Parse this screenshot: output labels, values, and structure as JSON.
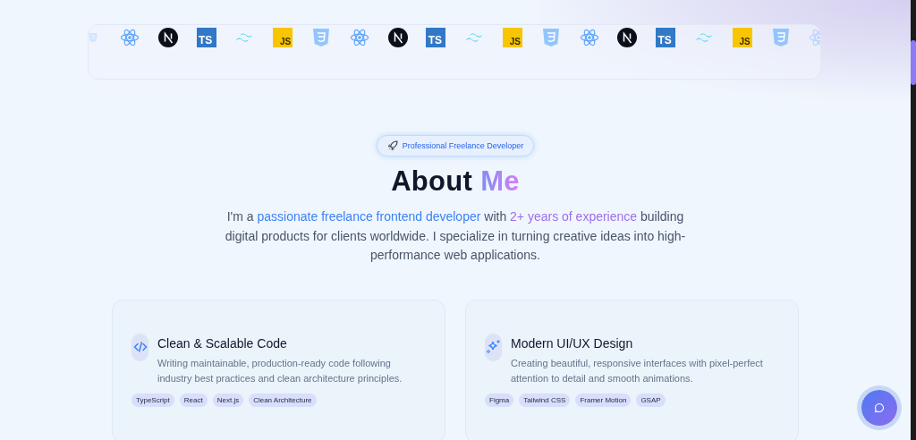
{
  "tech_strip": [
    {
      "kind": "css",
      "faded": true
    },
    {
      "kind": "react",
      "faded": false
    },
    {
      "kind": "next",
      "faded": false
    },
    {
      "kind": "ts",
      "label": "TS",
      "faded": false
    },
    {
      "kind": "tailwind",
      "faded": false
    },
    {
      "kind": "js",
      "label": "JS",
      "faded": false
    },
    {
      "kind": "css",
      "faded": false
    },
    {
      "kind": "react",
      "faded": false
    },
    {
      "kind": "next",
      "faded": false
    },
    {
      "kind": "ts",
      "label": "TS",
      "faded": false
    },
    {
      "kind": "tailwind",
      "faded": false
    },
    {
      "kind": "js",
      "label": "JS",
      "faded": false
    },
    {
      "kind": "css",
      "faded": false
    },
    {
      "kind": "react",
      "faded": false
    },
    {
      "kind": "next",
      "faded": false
    },
    {
      "kind": "ts",
      "label": "TS",
      "faded": false
    },
    {
      "kind": "tailwind",
      "faded": false
    },
    {
      "kind": "js",
      "label": "JS",
      "faded": false
    },
    {
      "kind": "css",
      "faded": false
    },
    {
      "kind": "react",
      "faded": true
    }
  ],
  "badge": "Professional Freelance Developer",
  "heading": {
    "main": "About",
    "accent": "Me"
  },
  "intro": [
    {
      "text": "I'm a ",
      "kind": "plain"
    },
    {
      "text": "passionate freelance frontend developer",
      "kind": "blue"
    },
    {
      "text": " with ",
      "kind": "plain"
    },
    {
      "text": "2+ years of experience",
      "kind": "purple"
    },
    {
      "text": " building digital products for clients worldwide. I specialize in turning creative ideas into high-performance web applications.",
      "kind": "plain"
    }
  ],
  "cards": [
    {
      "kind": "code",
      "title": "Clean & Scalable Code",
      "text": "Writing maintainable, production-ready code following industry best practices and clean architecture principles.",
      "tags": [
        "TypeScript",
        "React",
        "Next.js",
        "Clean Architecture"
      ]
    },
    {
      "kind": "sparkle",
      "title": "Modern UI/UX Design",
      "text": "Creating beautiful, responsive interfaces with pixel-perfect attention to detail and smooth animations.",
      "tags": [
        "Figma",
        "Tailwind CSS",
        "Framer Motion",
        "GSAP"
      ]
    }
  ]
}
